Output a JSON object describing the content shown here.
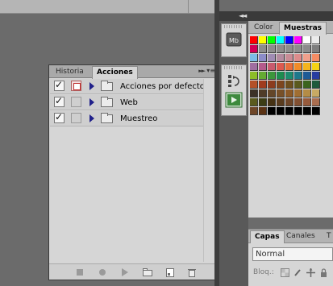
{
  "actions_panel": {
    "tabs": [
      {
        "label": "Historia",
        "active": false
      },
      {
        "label": "Acciones",
        "active": true
      }
    ],
    "collapse_icon": "double-chevron-right-icon",
    "menu_icon": "panel-menu-icon",
    "rows": [
      {
        "label": "Acciones por defecto",
        "checked": true,
        "dialog_toggle": true,
        "icon": "folder-icon"
      },
      {
        "label": "Web",
        "checked": true,
        "dialog_toggle": false,
        "icon": "folder-icon"
      },
      {
        "label": "Muestreo",
        "checked": true,
        "dialog_toggle": false,
        "icon": "folder-icon"
      }
    ],
    "footer_icons": [
      "stop-icon",
      "record-icon",
      "play-icon",
      "new-set-icon",
      "new-action-icon",
      "delete-icon"
    ]
  },
  "swatch_panel": {
    "tabs": [
      {
        "label": "Color",
        "active": false
      },
      {
        "label": "Muestras",
        "active": true
      }
    ],
    "swatch_rows": [
      [
        "#ff0000",
        "#ffff00",
        "#00ff00",
        "#00ffff",
        "#0000ff",
        "#ff00ff",
        "#ffffff",
        "#ebebeb"
      ],
      [
        "#d20055",
        "#8c8c8c",
        "#8c8c8c",
        "#8c8c8c",
        "#8c8c8c",
        "#8c8c8c",
        "#8c8c8c",
        "#7d7d7d"
      ],
      [
        "#7dbde6",
        "#8c8cc8",
        "#a08cb4",
        "#b48ca0",
        "#c88c96",
        "#dc8c8c",
        "#f0a08c",
        "#f58c64"
      ],
      [
        "#a06ea0",
        "#b45a8c",
        "#c85a6e",
        "#dc5a50",
        "#e66e3c",
        "#f08c28",
        "#f5b41e",
        "#f5d214"
      ],
      [
        "#8cbe28",
        "#64aa32",
        "#3c963c",
        "#1e8c50",
        "#1e8c6e",
        "#1e788c",
        "#1e5a96",
        "#283ca0"
      ],
      [
        "#b45028",
        "#a03c1e",
        "#8c3c1e",
        "#7d461e",
        "#6e501e",
        "#5a5a1e",
        "#3c641e",
        "#1e5a3c"
      ],
      [
        "#3c3228",
        "#503c28",
        "#644628",
        "#785028",
        "#8c5a28",
        "#a06e32",
        "#b48c46",
        "#c8aa64"
      ],
      [
        "#5a5a1e",
        "#3c3c14",
        "#463214",
        "#5a3c1e",
        "#6e4628",
        "#825032",
        "#965a3c",
        "#aa6e50"
      ],
      [
        "#6e4628",
        "#5a3214",
        "#000000",
        "#000000",
        "#000000",
        "#000000",
        "#000000",
        "#000000"
      ]
    ]
  },
  "layers_panel": {
    "tabs": [
      {
        "label": "Capas",
        "active": true
      },
      {
        "label": "Canales",
        "active": false
      },
      {
        "label": "T",
        "active": false
      }
    ],
    "blend_mode": "Normal",
    "lock_label": "Bloq.:"
  },
  "dock": {
    "top_group_icon": "mini-bridge-icon",
    "top_group_label": "Mb",
    "bottom_group_icons": [
      "history-icon",
      "actions-play-icon"
    ]
  },
  "colors": {
    "actions_check": "#111111",
    "expander": "#20208a",
    "dock_active": "#3d8a3d"
  }
}
